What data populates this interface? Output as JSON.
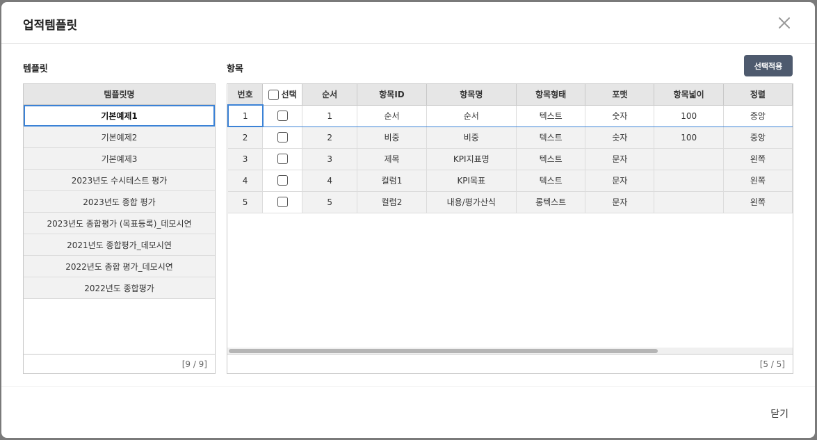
{
  "dialog": {
    "title": "업적템플릿",
    "close_label": "닫기"
  },
  "template_section": {
    "title": "템플릿",
    "column_header": "템플릿명",
    "items": [
      "기본예제1",
      "기본예제2",
      "기본예제3",
      "2023년도 수시테스트 평가",
      "2023년도 종합 평가",
      "2023년도 종합평가 (목표등록)_데모시연",
      "2021년도 종합평가_데모시연",
      "2022년도 종합 평가_데모시연",
      "2022년도 종합평가"
    ],
    "selected_index": 0,
    "count_label": "[9 / 9]"
  },
  "items_section": {
    "title": "항목",
    "apply_button": "선택적용",
    "columns": [
      "번호",
      "선택",
      "순서",
      "항목ID",
      "항목명",
      "항목형태",
      "포맷",
      "항목넓이",
      "정렬"
    ],
    "rows": [
      {
        "no": "1",
        "order": "1",
        "id": "순서",
        "name": "순서",
        "type": "텍스트",
        "format": "숫자",
        "width": "100",
        "align": "중앙"
      },
      {
        "no": "2",
        "order": "2",
        "id": "비중",
        "name": "비중",
        "type": "텍스트",
        "format": "숫자",
        "width": "100",
        "align": "중앙"
      },
      {
        "no": "3",
        "order": "3",
        "id": "제목",
        "name": "KPI지표명",
        "type": "텍스트",
        "format": "문자",
        "width": "",
        "align": "왼쪽"
      },
      {
        "no": "4",
        "order": "4",
        "id": "컬럼1",
        "name": "KPI목표",
        "type": "텍스트",
        "format": "문자",
        "width": "",
        "align": "왼쪽"
      },
      {
        "no": "5",
        "order": "5",
        "id": "컬럼2",
        "name": "내용/평가산식",
        "type": "롱텍스트",
        "format": "문자",
        "width": "",
        "align": "왼쪽"
      }
    ],
    "selected_row": 0,
    "count_label": "[5 / 5]"
  },
  "colors": {
    "accent": "#3b82d6",
    "button_bg": "#4e5a6e"
  },
  "icons": {
    "close": "close-icon"
  }
}
